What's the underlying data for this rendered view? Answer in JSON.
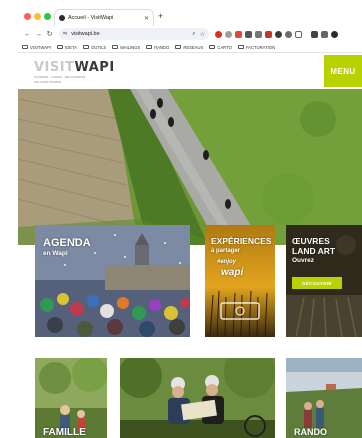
{
  "browser": {
    "tab_title": "Accueil - VisitWapi",
    "tab_close": "✕",
    "new_tab": "+",
    "url": "visitwapi.be",
    "bookmarks": [
      "VISITWAPI",
      "IDETA",
      "OUTILS",
      "MAILINGS",
      "RANDO",
      "RESEAUX",
      "CARTO",
      "FACTURATION"
    ]
  },
  "site": {
    "logo_light": "VISIT",
    "logo_dark": "WAPI",
    "logo_tagline_1": "TOURISME · LOISIRS · DÉCOUVERTES",
    "logo_tagline_2": "WALLONIE PICARDE",
    "menu_label": "MENU"
  },
  "cards": {
    "agenda": {
      "title": "AGENDA",
      "subtitle": "en Wapi"
    },
    "experiences": {
      "title": "EXPÉRIENCES",
      "subtitle": "à partager",
      "tag": "#enjoy",
      "tag2": "wapi"
    },
    "oeuvres": {
      "title_1": "ŒUVRES",
      "title_2": "LAND ART",
      "subtitle": "Ouvrez",
      "button": "DÉCOUVRIR"
    },
    "famille": {
      "title": "FAMILLE"
    },
    "rando": {
      "title": "RANDO"
    }
  },
  "colors": {
    "accent": "#b8d100",
    "dark_text": "#3a3a3a"
  }
}
